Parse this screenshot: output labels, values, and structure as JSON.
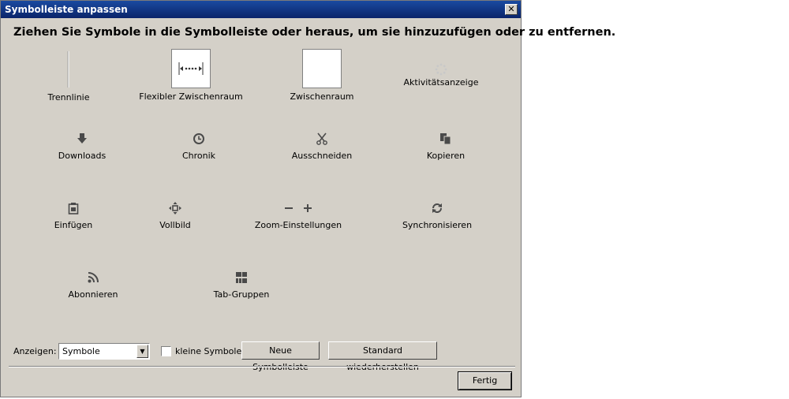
{
  "window": {
    "title": "Symbolleiste anpassen",
    "close_glyph": "✕"
  },
  "heading": "Ziehen Sie Symbole in die Symbolleiste oder heraus, um sie hinzuzufügen oder zu entfernen.",
  "items": {
    "separator": "Trennlinie",
    "flex_space": "Flexibler Zwischenraum",
    "space": "Zwischenraum",
    "activity": "Aktivitätsanzeige",
    "downloads": "Downloads",
    "history": "Chronik",
    "cut": "Ausschneiden",
    "copy": "Kopieren",
    "paste": "Einfügen",
    "fullscreen": "Vollbild",
    "zoom": "Zoom-Einstellungen",
    "sync": "Synchronisieren",
    "subscribe": "Abonnieren",
    "tabgroups": "Tab-Gruppen"
  },
  "footer": {
    "show_label": "Anzeigen:",
    "show_value": "Symbole",
    "small_icons_label": "kleine Symbole",
    "small_icons_checked": false,
    "new_toolbar": "Neue Symbolleiste",
    "restore_default": "Standard wiederherstellen",
    "done": "Fertig"
  },
  "colors": {
    "dialog_bg": "#d4d0c8",
    "titlebar": "#0a246a",
    "icon": "#4a4a4a"
  }
}
